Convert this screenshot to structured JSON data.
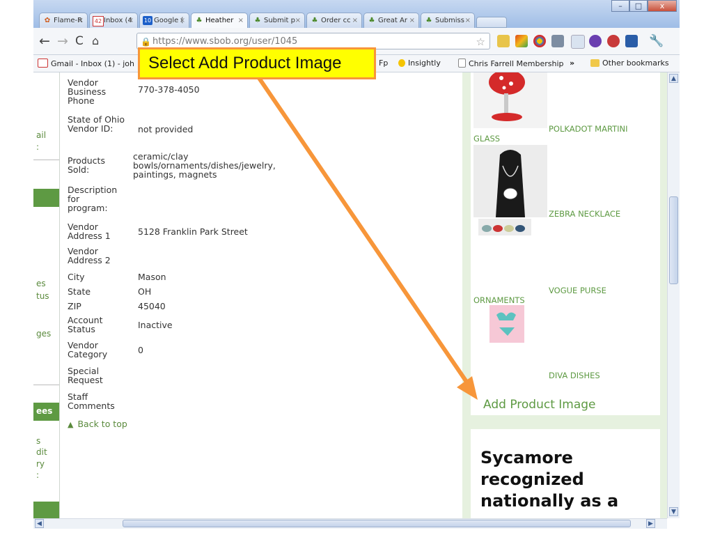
{
  "browser": {
    "tabs": [
      {
        "label": "Flame-R",
        "icon": "flame-icon"
      },
      {
        "label": "Inbox (4",
        "icon": "gmail-icon"
      },
      {
        "label": "Google (",
        "icon": "google-calendar-icon"
      },
      {
        "label": "Heather",
        "icon": "sbob-icon"
      },
      {
        "label": "Submit p",
        "icon": "sbob-icon"
      },
      {
        "label": "Order cc",
        "icon": "sbob-icon"
      },
      {
        "label": "Great Ar",
        "icon": "sbob-icon"
      },
      {
        "label": "Submiss",
        "icon": "sbob-icon"
      }
    ],
    "tab_close": "×",
    "gmail_badge": "42",
    "calendar_badge": "10",
    "url": "https://www.sbob.org/user/1045",
    "bookmarks": [
      {
        "label": "Gmail - Inbox (1) - joh",
        "icon": "gmail-icon"
      },
      {
        "label": "Fp",
        "icon": "folder-icon"
      },
      {
        "label": "Insightly",
        "icon": "lightbulb-icon"
      },
      {
        "label": "Chris Farrell Membership",
        "icon": "page-icon"
      }
    ],
    "bookmark_overflow": "»",
    "other_bookmarks": "Other bookmarks"
  },
  "annotation": {
    "text": "Select Add Product Image",
    "colors": {
      "fill": "#ffff00",
      "border": "#f7963a",
      "arrow": "#f7963a"
    }
  },
  "left_nav": {
    "fragments": [
      "ail",
      ":",
      "es",
      "tus",
      "ges",
      "ees",
      "s",
      "dit",
      "ry",
      ":"
    ]
  },
  "vendor": {
    "fields": [
      {
        "label": "Vendor Business Phone",
        "value": "770-378-4050"
      },
      {
        "label": "State of Ohio Vendor ID:",
        "value": "not provided"
      },
      {
        "label": "Products Sold:",
        "value": "ceramic/clay bowls/ornaments/dishes/jewelry, paintings, magnets"
      },
      {
        "label": "Description for program:",
        "value": ""
      },
      {
        "label": "Vendor Address 1",
        "value": "5128 Franklin Park Street"
      },
      {
        "label": "Vendor Address 2",
        "value": ""
      },
      {
        "label": "City",
        "value": "Mason"
      },
      {
        "label": "State",
        "value": "OH"
      },
      {
        "label": "ZIP",
        "value": "45040"
      },
      {
        "label": "Account Status",
        "value": "Inactive"
      },
      {
        "label": "Vendor Category",
        "value": "0"
      },
      {
        "label": "Special Request",
        "value": ""
      },
      {
        "label": "Staff Comments",
        "value": ""
      }
    ],
    "back_to_top": "Back to top"
  },
  "products": {
    "items": [
      "POLKADOT MARTINI",
      "GLASS",
      "ZEBRA NECKLACE",
      "VOGUE PURSE",
      "ORNAMENTS",
      "DIVA DISHES"
    ],
    "add_image": "Add Product Image"
  },
  "news": {
    "headline": "Sycamore recognized nationally as a"
  },
  "colors": {
    "accent_green": "#5e9a43",
    "panel_bg": "#e6f1df"
  }
}
